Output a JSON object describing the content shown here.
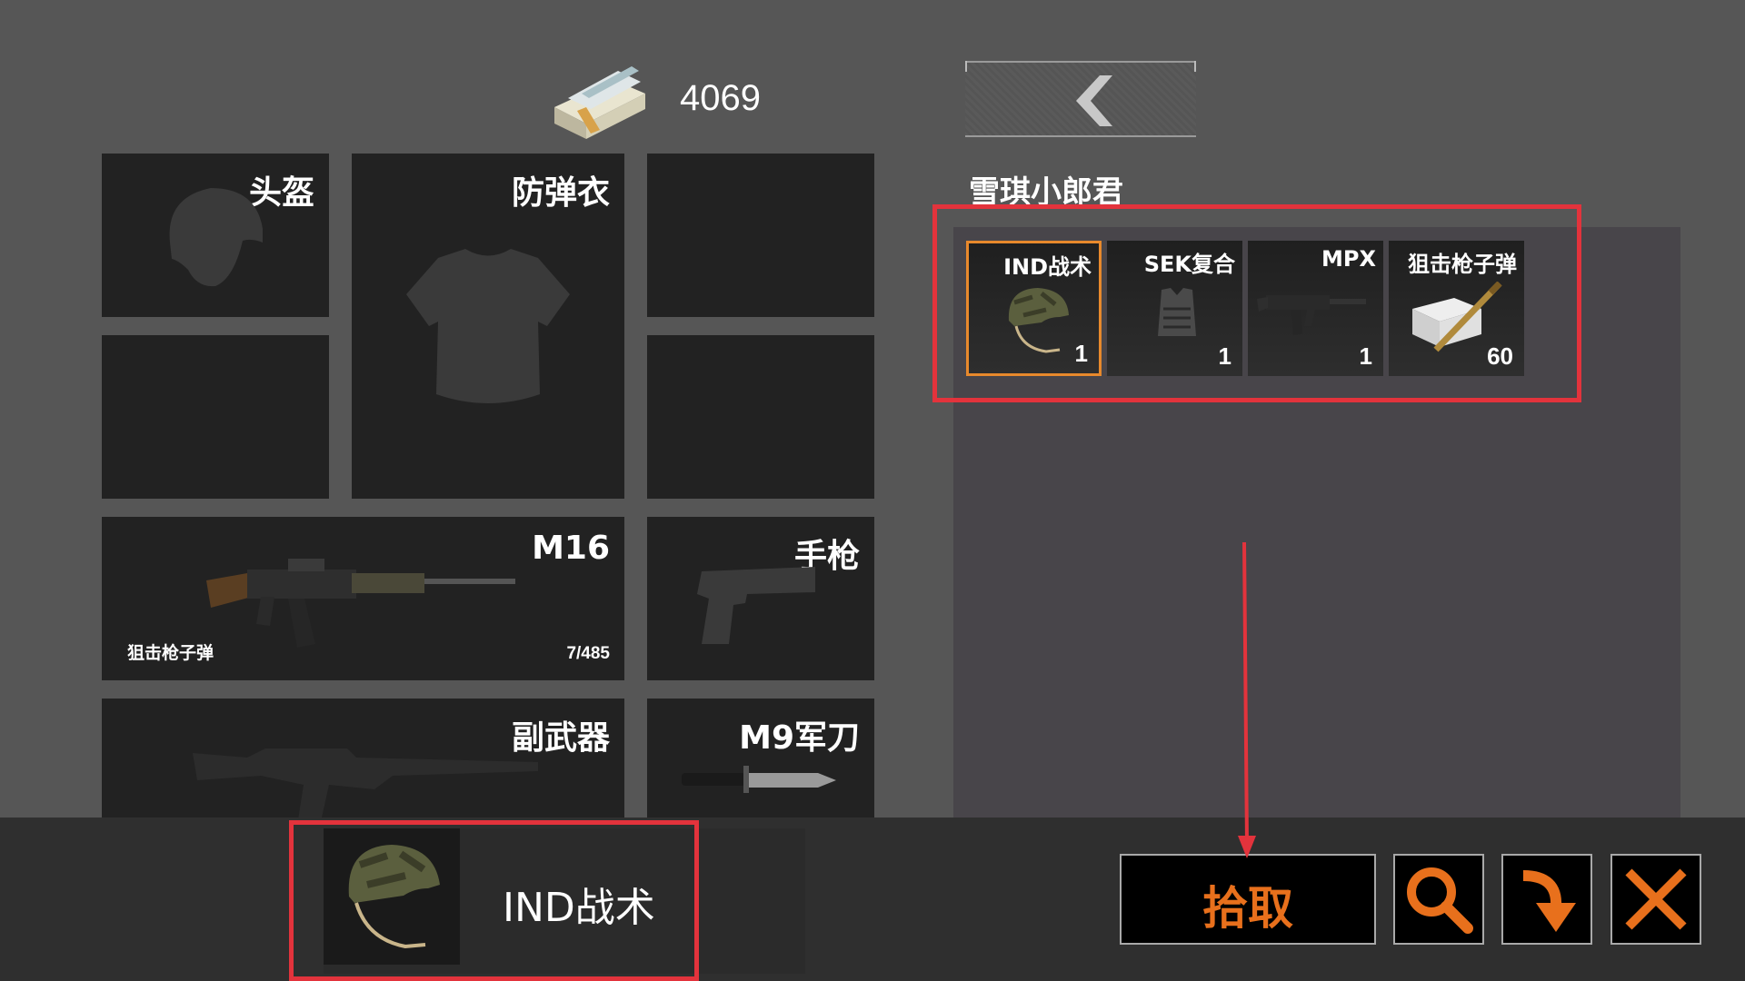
{
  "money": {
    "amount": "4069",
    "icon": "cash-stack-icon"
  },
  "back_button": {
    "icon": "chevron-left-icon"
  },
  "equipment": {
    "helmet_label": "头盔",
    "vest_label": "防弹衣",
    "primary": {
      "name": "M16",
      "ammo_type": "狙击枪子弹",
      "ammo": "7/485"
    },
    "pistol_label": "手枪",
    "secondary_label": "副武器",
    "melee_label": "M9军刀"
  },
  "loot": {
    "owner": "雪琪小郎君",
    "items": [
      {
        "name": "IND战术",
        "count": "1",
        "icon": "helmet-icon",
        "selected": true
      },
      {
        "name": "SEK复合",
        "count": "1",
        "icon": "vest-icon",
        "selected": false
      },
      {
        "name": "MPX",
        "count": "1",
        "icon": "smg-icon",
        "selected": false
      },
      {
        "name": "狙击枪子弹",
        "count": "60",
        "icon": "ammo-icon",
        "selected": false
      }
    ]
  },
  "selected_item": {
    "name": "IND战术",
    "icon": "helmet-icon"
  },
  "actions": {
    "pickup_label": "拾取",
    "search_icon": "search-icon",
    "drop_icon": "drop-arrow-icon",
    "close_icon": "close-icon"
  },
  "colors": {
    "accent": "#e8701c",
    "highlight": "#e3333c",
    "selected_border": "#e8892c"
  }
}
